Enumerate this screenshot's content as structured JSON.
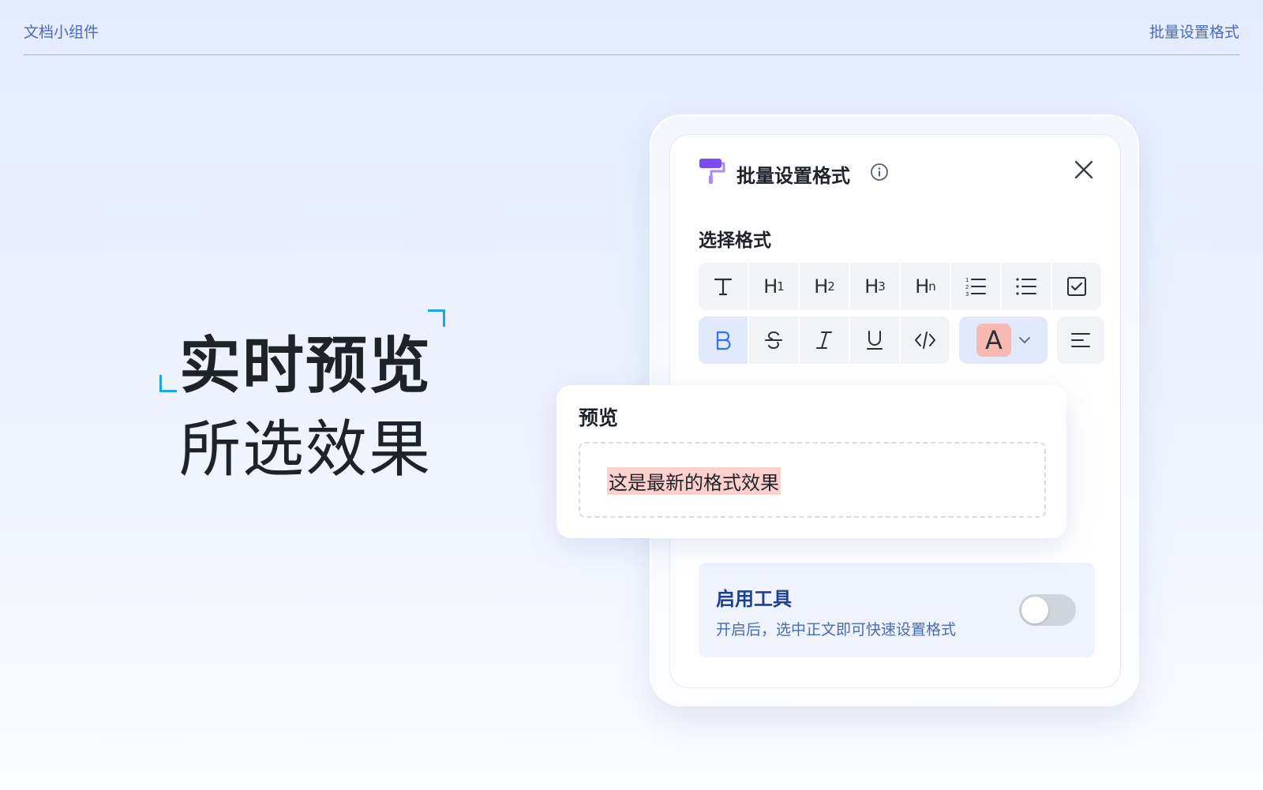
{
  "header": {
    "left_label": "文档小组件",
    "right_label": "批量设置格式"
  },
  "hero": {
    "line1": "实时预览",
    "line2": "所选效果"
  },
  "panel": {
    "title": "批量设置格式",
    "section_label": "选择格式",
    "row1": [
      {
        "name": "text",
        "label": "T"
      },
      {
        "name": "h1",
        "label": "H",
        "sub": "1"
      },
      {
        "name": "h2",
        "label": "H",
        "sub": "2"
      },
      {
        "name": "h3",
        "label": "H",
        "sub": "3"
      },
      {
        "name": "hn",
        "label": "H",
        "sub": "n"
      }
    ],
    "color_letter": "A",
    "accent_color": "#3370ff",
    "highlight_color": "#f7b9b2"
  },
  "preview": {
    "title": "预览",
    "sample_text": "这是最新的格式效果"
  },
  "enable": {
    "title": "启用工具",
    "description": "开启后，选中正文即可快速设置格式",
    "enabled": false
  }
}
